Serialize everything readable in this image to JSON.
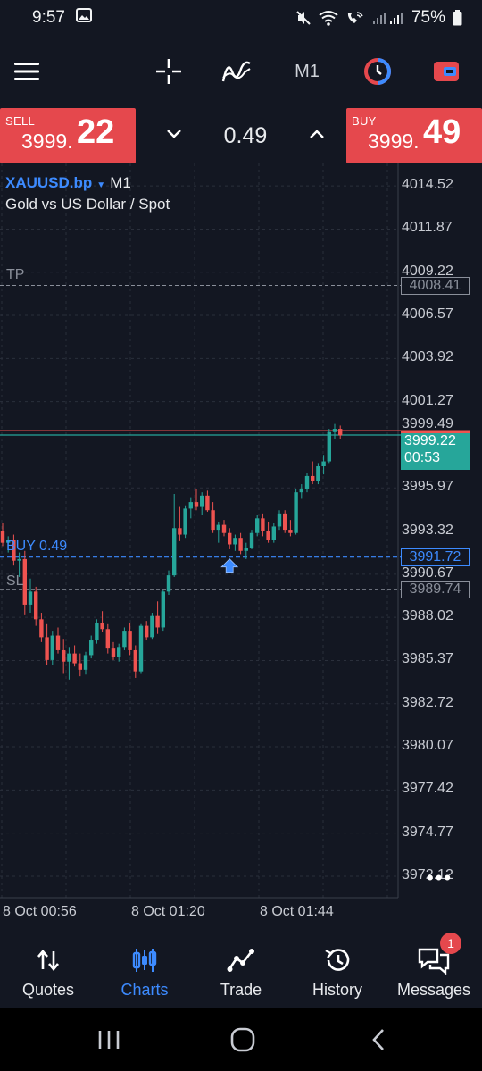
{
  "status_bar": {
    "time": "9:57",
    "battery": "75%",
    "icons": [
      "gallery-icon",
      "mute-icon",
      "wifi-icon",
      "wifi-call-icon",
      "signal-icon",
      "battery-icon"
    ]
  },
  "toolbar": {
    "timeframe": "M1",
    "icons": [
      "menu-icon",
      "crosshair-icon",
      "indicators-icon",
      "timeframe",
      "one-click-trading-icon",
      "trade-toggle-icon"
    ]
  },
  "trade_panel": {
    "sell_label": "SELL",
    "sell_price_small": "3999.",
    "sell_price_big": "22",
    "buy_label": "BUY",
    "buy_price_small": "3999.",
    "buy_price_big": "49",
    "lot": "0.49"
  },
  "chart": {
    "symbol": "XAUUSD.bp",
    "timeframe": "M1",
    "description": "Gold vs US Dollar / Spot",
    "tp_label": "TP",
    "tp_price": "4008.41",
    "buy_label": "BUY 0.49",
    "buy_price": "3991.72",
    "sl_label": "SL",
    "sl_price": "3989.74",
    "current_price": "3999.22",
    "countdown": "00:53",
    "partial_ask": "3999.49",
    "price_axis": [
      "4014.52",
      "4011.87",
      "4009.22",
      "4006.57",
      "4003.92",
      "4001.27",
      "3995.97",
      "3993.32",
      "3990.67",
      "3988.02",
      "3985.37",
      "3982.72",
      "3980.07",
      "3977.42",
      "3974.77",
      "3972.12"
    ],
    "time_axis": [
      "8 Oct 00:56",
      "8 Oct 01:20",
      "8 Oct 01:44"
    ],
    "more": "•••",
    "colors": {
      "up": "#26a69a",
      "down": "#ef5350",
      "bid": "#26a69a",
      "ask": "#ef5350",
      "orders": "#3d8bff",
      "levels": "#8a8f9a"
    }
  },
  "chart_data": {
    "type": "candlestick",
    "symbol": "XAUUSD.bp",
    "timeframe": "M1",
    "ylim": [
      3970.8,
      4015.9
    ],
    "x_labels": [
      "8 Oct 00:56",
      "8 Oct 01:20",
      "8 Oct 01:44"
    ],
    "candles": [
      {
        "o": 3993.3,
        "h": 3993.8,
        "l": 3992.4,
        "c": 3992.6
      },
      {
        "o": 3992.6,
        "h": 3993.0,
        "l": 3992.0,
        "c": 3992.8
      },
      {
        "o": 3992.8,
        "h": 3993.1,
        "l": 3991.2,
        "c": 3991.5
      },
      {
        "o": 3991.5,
        "h": 3992.0,
        "l": 3990.5,
        "c": 3991.6
      },
      {
        "o": 3991.6,
        "h": 3992.1,
        "l": 3988.2,
        "c": 3988.8
      },
      {
        "o": 3988.8,
        "h": 3990.4,
        "l": 3988.3,
        "c": 3989.6
      },
      {
        "o": 3989.6,
        "h": 3989.9,
        "l": 3987.5,
        "c": 3987.9
      },
      {
        "o": 3987.9,
        "h": 3988.3,
        "l": 3986.5,
        "c": 3986.8
      },
      {
        "o": 3986.8,
        "h": 3987.6,
        "l": 3985.1,
        "c": 3985.4
      },
      {
        "o": 3985.4,
        "h": 3987.2,
        "l": 3985.1,
        "c": 3986.9
      },
      {
        "o": 3986.9,
        "h": 3987.4,
        "l": 3985.8,
        "c": 3986.0
      },
      {
        "o": 3986.0,
        "h": 3986.7,
        "l": 3984.6,
        "c": 3985.3
      },
      {
        "o": 3985.3,
        "h": 3986.2,
        "l": 3984.2,
        "c": 3985.8
      },
      {
        "o": 3985.8,
        "h": 3986.3,
        "l": 3985.0,
        "c": 3985.2
      },
      {
        "o": 3985.2,
        "h": 3985.8,
        "l": 3984.4,
        "c": 3984.8
      },
      {
        "o": 3984.8,
        "h": 3985.9,
        "l": 3984.5,
        "c": 3985.7
      },
      {
        "o": 3985.7,
        "h": 3986.9,
        "l": 3985.5,
        "c": 3986.6
      },
      {
        "o": 3986.6,
        "h": 3987.9,
        "l": 3986.4,
        "c": 3987.7
      },
      {
        "o": 3987.7,
        "h": 3988.4,
        "l": 3987.1,
        "c": 3987.3
      },
      {
        "o": 3987.3,
        "h": 3987.6,
        "l": 3985.8,
        "c": 3986.1
      },
      {
        "o": 3986.1,
        "h": 3986.5,
        "l": 3985.4,
        "c": 3985.6
      },
      {
        "o": 3985.6,
        "h": 3986.4,
        "l": 3985.3,
        "c": 3986.2
      },
      {
        "o": 3986.2,
        "h": 3987.4,
        "l": 3986.0,
        "c": 3987.2
      },
      {
        "o": 3987.2,
        "h": 3987.7,
        "l": 3985.7,
        "c": 3986.0
      },
      {
        "o": 3986.0,
        "h": 3986.3,
        "l": 3984.3,
        "c": 3984.7
      },
      {
        "o": 3984.7,
        "h": 3987.6,
        "l": 3984.6,
        "c": 3987.5
      },
      {
        "o": 3987.5,
        "h": 3987.8,
        "l": 3986.6,
        "c": 3986.8
      },
      {
        "o": 3986.8,
        "h": 3988.3,
        "l": 3986.7,
        "c": 3988.1
      },
      {
        "o": 3988.1,
        "h": 3989.0,
        "l": 3987.0,
        "c": 3987.4
      },
      {
        "o": 3987.4,
        "h": 3989.7,
        "l": 3987.2,
        "c": 3989.6
      },
      {
        "o": 3989.6,
        "h": 3990.9,
        "l": 3989.4,
        "c": 3990.6
      },
      {
        "o": 3990.6,
        "h": 3995.6,
        "l": 3990.5,
        "c": 3993.5
      },
      {
        "o": 3993.5,
        "h": 3994.8,
        "l": 3992.7,
        "c": 3993.1
      },
      {
        "o": 3993.1,
        "h": 3994.9,
        "l": 3992.9,
        "c": 3994.7
      },
      {
        "o": 3994.7,
        "h": 3995.4,
        "l": 3994.1,
        "c": 3995.1
      },
      {
        "o": 3995.1,
        "h": 3995.9,
        "l": 3994.6,
        "c": 3994.8
      },
      {
        "o": 3994.8,
        "h": 3995.7,
        "l": 3994.3,
        "c": 3995.5
      },
      {
        "o": 3995.5,
        "h": 3995.8,
        "l": 3994.5,
        "c": 3994.6
      },
      {
        "o": 3994.6,
        "h": 3995.1,
        "l": 3993.2,
        "c": 3993.4
      },
      {
        "o": 3993.4,
        "h": 3993.9,
        "l": 3992.6,
        "c": 3993.7
      },
      {
        "o": 3993.7,
        "h": 3994.0,
        "l": 3993.0,
        "c": 3993.2
      },
      {
        "o": 3993.2,
        "h": 3993.5,
        "l": 3992.2,
        "c": 3992.5
      },
      {
        "o": 3992.5,
        "h": 3993.1,
        "l": 3992.1,
        "c": 3992.9
      },
      {
        "o": 3992.9,
        "h": 3993.2,
        "l": 3991.9,
        "c": 3992.1
      },
      {
        "o": 3992.1,
        "h": 3992.6,
        "l": 3991.6,
        "c": 3992.3
      },
      {
        "o": 3992.3,
        "h": 3993.4,
        "l": 3992.2,
        "c": 3993.2
      },
      {
        "o": 3993.2,
        "h": 3994.3,
        "l": 3993.0,
        "c": 3994.1
      },
      {
        "o": 3994.1,
        "h": 3994.4,
        "l": 3993.0,
        "c": 3993.3
      },
      {
        "o": 3993.3,
        "h": 3993.9,
        "l": 3992.6,
        "c": 3992.8
      },
      {
        "o": 3992.8,
        "h": 3993.8,
        "l": 3992.6,
        "c": 3993.6
      },
      {
        "o": 3993.6,
        "h": 3994.6,
        "l": 3993.4,
        "c": 3994.4
      },
      {
        "o": 3994.4,
        "h": 3994.6,
        "l": 3993.2,
        "c": 3993.4
      },
      {
        "o": 3993.4,
        "h": 3994.0,
        "l": 3993.0,
        "c": 3993.2
      },
      {
        "o": 3993.2,
        "h": 3995.9,
        "l": 3993.1,
        "c": 3995.7
      },
      {
        "o": 3995.7,
        "h": 3996.2,
        "l": 3995.3,
        "c": 3995.9
      },
      {
        "o": 3995.9,
        "h": 3996.9,
        "l": 3995.7,
        "c": 3996.7
      },
      {
        "o": 3996.7,
        "h": 3997.6,
        "l": 3996.2,
        "c": 3996.4
      },
      {
        "o": 3996.4,
        "h": 3997.5,
        "l": 3996.2,
        "c": 3997.3
      },
      {
        "o": 3997.3,
        "h": 3998.0,
        "l": 3996.8,
        "c": 3997.6
      },
      {
        "o": 3997.6,
        "h": 3999.6,
        "l": 3997.5,
        "c": 3999.4
      },
      {
        "o": 3999.4,
        "h": 3999.9,
        "l": 3999.0,
        "c": 3999.6
      },
      {
        "o": 3999.6,
        "h": 3999.8,
        "l": 3999.0,
        "c": 3999.2
      }
    ],
    "levels": {
      "tp": 4008.41,
      "buy": 3991.72,
      "sl": 3989.74,
      "bid": 3999.22,
      "ask": 3999.49
    }
  },
  "nav": {
    "items": [
      {
        "label": "Quotes"
      },
      {
        "label": "Charts"
      },
      {
        "label": "Trade"
      },
      {
        "label": "History"
      },
      {
        "label": "Messages"
      }
    ],
    "messages_badge": "1"
  }
}
